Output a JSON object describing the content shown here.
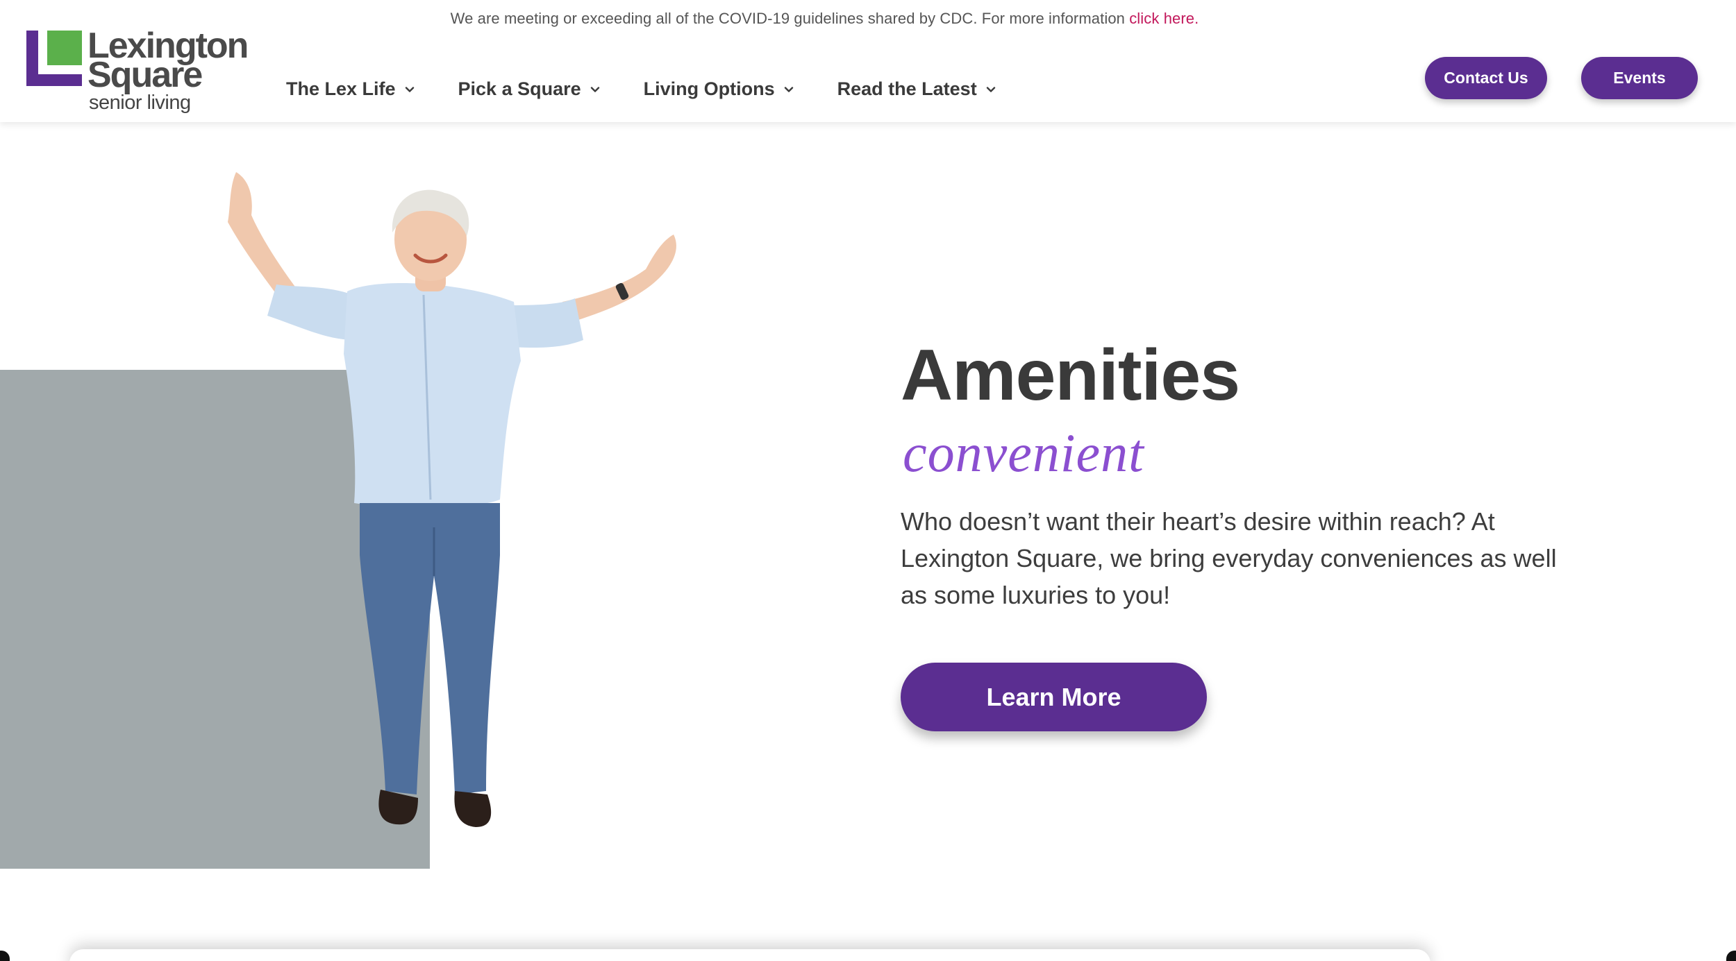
{
  "topbar": {
    "notice": "We are meeting or exceeding all of the COVID-19 guidelines shared by CDC. For more information ",
    "link_text": "click here."
  },
  "logo": {
    "line1": "Lexington",
    "line2": "Square",
    "line3": "senior living"
  },
  "nav": {
    "items": [
      {
        "label": "The Lex Life"
      },
      {
        "label": "Pick a Square"
      },
      {
        "label": "Living Options"
      },
      {
        "label": "Read the Latest"
      }
    ]
  },
  "header_buttons": {
    "contact": "Contact Us",
    "events": "Events"
  },
  "hero": {
    "title": "Amenities",
    "subtitle": "convenient",
    "body": "Who doesn’t want their heart’s desire within reach?  At Lexington Square, we bring everyday conveniences as well as some luxuries to you!",
    "cta": "Learn More"
  },
  "colors": {
    "brand_purple": "#5b2e91",
    "accent_purple": "#8b4fd0",
    "brand_green": "#5bb04b",
    "link_red": "#c2185b",
    "block_gray": "#a1a9ab"
  },
  "icons": {
    "nav_chevron": "chevron-down-icon"
  }
}
